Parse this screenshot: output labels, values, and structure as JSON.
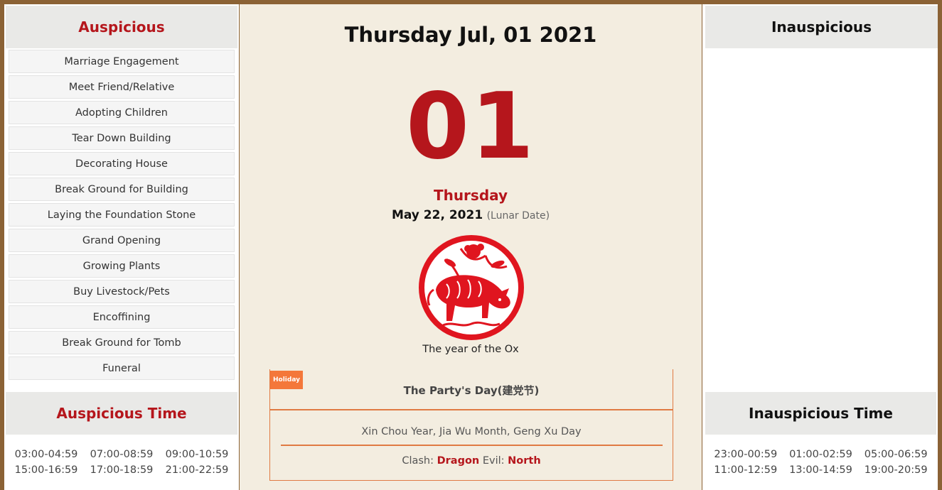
{
  "header": {
    "date_title": "Thursday Jul, 01 2021",
    "day_number": "01",
    "weekday": "Thursday",
    "lunar_date": "May 22, 2021",
    "lunar_note": "(Lunar Date)",
    "zodiac_icon": "ox-papercut-icon",
    "zodiac_caption": "The year of the Ox"
  },
  "auspicious": {
    "title": "Auspicious",
    "items": [
      "Marriage Engagement",
      "Meet Friend/Relative",
      "Adopting Children",
      "Tear Down Building",
      "Decorating House",
      "Break Ground for Building",
      "Laying the Foundation Stone",
      "Grand Opening",
      "Growing Plants",
      "Buy Livestock/Pets",
      "Encoffining",
      "Break Ground for Tomb",
      "Funeral"
    ]
  },
  "inauspicious": {
    "title": "Inauspicious",
    "items": []
  },
  "auspicious_time": {
    "title": "Auspicious Time",
    "slots": [
      "03:00-04:59",
      "07:00-08:59",
      "09:00-10:59",
      "15:00-16:59",
      "17:00-18:59",
      "21:00-22:59"
    ]
  },
  "inauspicious_time": {
    "title": "Inauspicious Time",
    "slots": [
      "23:00-00:59",
      "01:00-02:59",
      "05:00-06:59",
      "11:00-12:59",
      "13:00-14:59",
      "19:00-20:59"
    ]
  },
  "info": {
    "badge": "Holiday",
    "holiday": "The Party's Day(建党节)",
    "ganzhi": "Xin Chou Year, Jia Wu Month, Geng Xu Day",
    "clash_label": "Clash:",
    "clash_value": "Dragon",
    "evil_label": "Evil:",
    "evil_value": "North"
  },
  "colors": {
    "accent_red": "#b5161c",
    "frame_brown": "#8b6235",
    "badge_orange": "#f4773a",
    "divider_orange": "#e07a43"
  }
}
